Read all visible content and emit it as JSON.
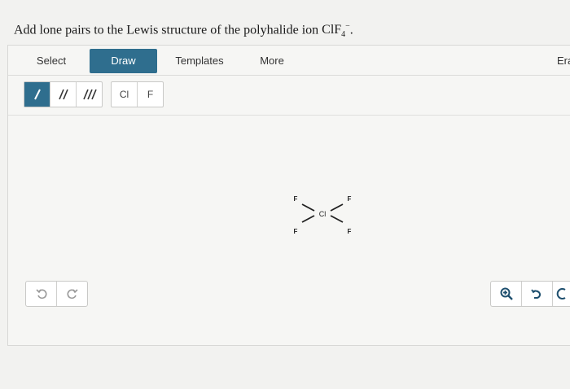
{
  "question": {
    "text": "Add lone pairs to the Lewis structure of the polyhalide ion",
    "ion_base": "ClF",
    "ion_subscript": "4",
    "ion_superscript": "−",
    "trailing": "."
  },
  "toolbar": {
    "tabs": [
      {
        "label": "Select"
      },
      {
        "label": "Draw"
      },
      {
        "label": "Templates"
      },
      {
        "label": "More"
      },
      {
        "label": "Era"
      }
    ],
    "active_tab": "Draw"
  },
  "bond_tools": [
    "single-bond-icon",
    "double-bond-icon",
    "triple-bond-icon"
  ],
  "atom_tools": [
    {
      "label": "Cl"
    },
    {
      "label": "F"
    }
  ],
  "molecule": {
    "center_atom": "Cl",
    "ligand_atoms": [
      "F",
      "F",
      "F",
      "F"
    ]
  },
  "history_tools": [
    "undo-icon",
    "redo-icon"
  ],
  "view_tools": [
    "zoom-in-icon",
    "reset-view-icon",
    "clear-icon"
  ],
  "colors": {
    "accent": "#2f6e8e",
    "icon": "#1e4f6e"
  }
}
